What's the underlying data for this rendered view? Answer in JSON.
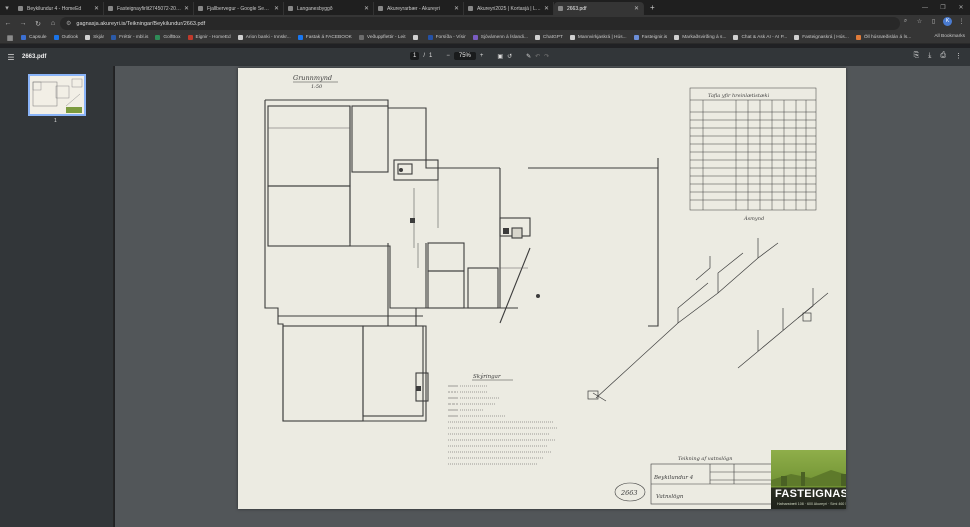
{
  "browser": {
    "tabs": [
      {
        "title": "Beykilundur 4 - HomeEd",
        "active": false
      },
      {
        "title": "Fasteignayfirlit2745072-202602",
        "active": false
      },
      {
        "title": "Fjallbervegur - Google Search",
        "active": false
      },
      {
        "title": "Langanesbyggð",
        "active": false
      },
      {
        "title": "Akureyrarbær - Akureyri",
        "active": false
      },
      {
        "title": "Akureyri2025 | Kortasjá | Loftm",
        "active": false
      },
      {
        "title": "2663.pdf",
        "active": true
      }
    ],
    "url": "gagnasja.akureyri.is/Teikningar/Beykilundur/2663.pdf",
    "bookmarks": [
      {
        "label": "Capsule",
        "color": "#3b6fd1"
      },
      {
        "label": "Outlook",
        "color": "#1a73e8"
      },
      {
        "label": "Skjár",
        "color": "#cfcfcf"
      },
      {
        "label": "Fréttir - mbl.is",
        "color": "#2b5aa8"
      },
      {
        "label": "GolfBox",
        "color": "#2e8b57"
      },
      {
        "label": "Eignir - HomeEd",
        "color": "#c0392b"
      },
      {
        "label": "Arion banki - Innskr...",
        "color": "#cfcfcf"
      },
      {
        "label": "Fastak á FACEBOOK",
        "color": "#1877f2"
      },
      {
        "label": "Veðuppflettir - Leit",
        "color": "#6d6d6d"
      },
      {
        "label": "",
        "color": "#cfcfcf"
      },
      {
        "label": "Forsíða - Vísir",
        "color": "#2451a6"
      },
      {
        "label": "Sjóvámenn á Íslandi...",
        "color": "#7a5cc2"
      },
      {
        "label": "ChatGPT",
        "color": "#cfcfcf"
      },
      {
        "label": "Mannvirkjaskrá | Hús...",
        "color": "#cfcfcf"
      },
      {
        "label": "Fasteignir.is",
        "color": "#6c8ed8"
      },
      {
        "label": "Markaðsvirðing á s...",
        "color": "#cfcfcf"
      },
      {
        "label": "Chat & Ask AI - AI P...",
        "color": "#cfcfcf"
      },
      {
        "label": "Fasteignaskrá | Hús...",
        "color": "#cfcfcf"
      },
      {
        "label": "Öll húsnæðislán á Ís...",
        "color": "#e07b39"
      }
    ],
    "all_bookmarks": "All Bookmarks",
    "profile_initial": "K"
  },
  "pdf": {
    "filename": "2663.pdf",
    "page_current": "1",
    "page_sep": "/",
    "page_total": "1",
    "zoom": "75%",
    "thumb_number": "1"
  },
  "drawing": {
    "title_floorplan": "Grunnmynd",
    "title_floorplan_sub": "1:50",
    "table_title": "Tafla yfir hreinlætistæki",
    "isometric_title": "Ásmynd",
    "legend_title": "Skýringar",
    "caption": "Teikning af vatnslögn",
    "address": "Beykilundur 4",
    "subject": "Vatnslögn",
    "stamp": "2663",
    "logo_text": "FASTEIGNASALA AKUREYRAR"
  }
}
